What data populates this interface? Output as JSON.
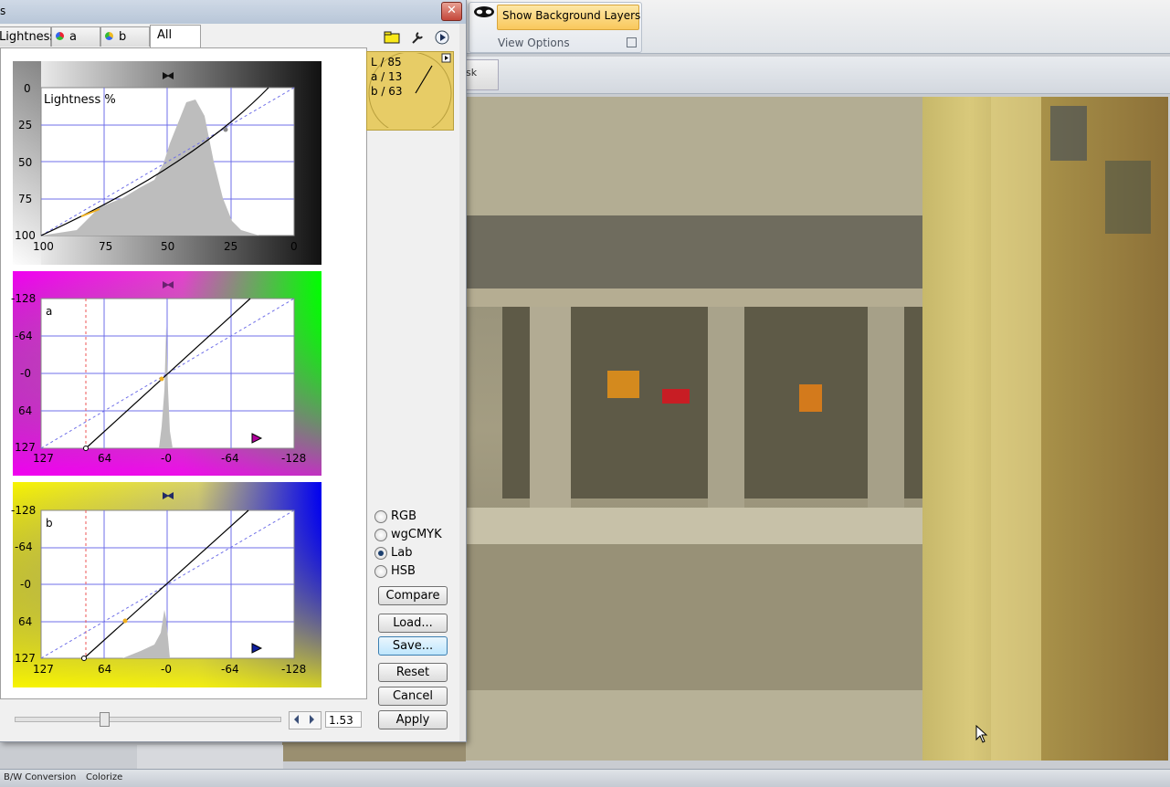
{
  "background_app": {
    "ribbon": {
      "show_bg_layers": "Show Background Layers",
      "group_label": "View Options"
    },
    "toolbar2_text": "sk",
    "status_tabs": [
      "B/W Conversion",
      "Colorize"
    ]
  },
  "dialog": {
    "title_fragment": "s",
    "close_glyph": "✕",
    "tabs": [
      {
        "label": "Lightness"
      },
      {
        "label": "a"
      },
      {
        "label": "b"
      },
      {
        "label": "All"
      }
    ],
    "info": {
      "L": "L /  85",
      "a": "a /  13",
      "b": "b /  63"
    },
    "curves": {
      "lightness": {
        "label": "Lightness %",
        "y_ticks": [
          "0",
          "25",
          "50",
          "75",
          "100"
        ],
        "x_ticks": [
          "100",
          "75",
          "50",
          "25",
          "0"
        ]
      },
      "a": {
        "label": "a",
        "y_ticks": [
          "-128",
          "-64",
          "-0",
          "64",
          "127"
        ],
        "x_ticks": [
          "127",
          "64",
          "-0",
          "-64",
          "-128"
        ]
      },
      "b": {
        "label": "b",
        "y_ticks": [
          "-128",
          "-64",
          "-0",
          "64",
          "127"
        ],
        "x_ticks": [
          "127",
          "64",
          "-0",
          "-64",
          "-128"
        ]
      }
    },
    "modes": [
      {
        "label": "RGB",
        "selected": false
      },
      {
        "label": "wgCMYK",
        "selected": false
      },
      {
        "label": "Lab",
        "selected": true
      },
      {
        "label": "HSB",
        "selected": false
      }
    ],
    "buttons": {
      "compare": "Compare",
      "load": "Load...",
      "save": "Save...",
      "reset": "Reset",
      "cancel": "Cancel",
      "apply": "Apply"
    },
    "zoom_value": "1.53"
  },
  "colors": {
    "magenta": "#f000f0",
    "green": "#00ff00",
    "yellow": "#f8f400",
    "blue": "#0000f0",
    "info_bg": "#e7cc66"
  }
}
